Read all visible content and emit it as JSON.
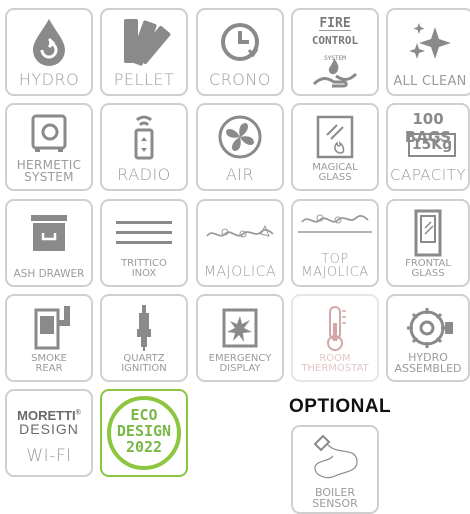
{
  "tiles": {
    "hydro": {
      "label": "HYDRO",
      "icon": "water-drop-icon"
    },
    "pellet": {
      "label": "PELLET",
      "icon": "pellet-swatch-icon"
    },
    "crono": {
      "label": "CRONO",
      "icon": "clock-icon"
    },
    "fire_control": {
      "title": "FIRE",
      "sub": "CONTROL",
      "sub2": "SYSTEM",
      "icon": "hand-flame-icon"
    },
    "all_clean": {
      "label": "ALL CLEAN",
      "icon": "sparkle-icon"
    },
    "hermetic": {
      "label1": "HERMETIC",
      "label2": "SYSTEM",
      "icon": "safe-icon"
    },
    "radio": {
      "label": "RADIO",
      "icon": "remote-icon"
    },
    "air": {
      "label": "AIR",
      "icon": "fan-icon"
    },
    "magical_glass": {
      "label1": "MAGICAL",
      "label2": "GLASS",
      "icon": "glass-flame-icon"
    },
    "capacity": {
      "top": "100 BAGS",
      "badge": "15Kg",
      "label": "CAPACITY"
    },
    "ash_drawer": {
      "label": "ASH DRAWER",
      "icon": "drawer-icon"
    },
    "trittico": {
      "label1": "TRITTICO",
      "label2": "INOX",
      "icon": "lines-icon"
    },
    "majolica": {
      "label": "MAJOLICA",
      "icon": "ornament-icon"
    },
    "top_majolica": {
      "label1": "TOP",
      "label2": "MAJOLICA",
      "icon": "ornament-icon"
    },
    "frontal_glass": {
      "label1": "FRONTAL",
      "label2": "GLASS",
      "icon": "stove-glass-icon"
    },
    "smoke_rear": {
      "label1": "SMOKE",
      "label2": "REAR",
      "icon": "stove-rear-icon"
    },
    "quartz": {
      "label1": "QUARTZ",
      "label2": "IGNITION",
      "icon": "spark-plug-icon"
    },
    "emergency": {
      "label1": "EMERGENCY",
      "label2": "DISPLAY",
      "icon": "broken-display-icon"
    },
    "room_thermo": {
      "label1": "ROOM",
      "label2": "THERMOSTAT",
      "icon": "thermometer-icon"
    },
    "hydro_assembled": {
      "label1": "HYDRO",
      "label2": "ASSEMBLED",
      "icon": "pump-icon"
    },
    "wifi": {
      "brand1": "MORETTI",
      "brand2": "DESIGN",
      "label": "WI-FI",
      "mark": "®"
    },
    "eco": {
      "l1": "ECO",
      "l2": "DESIGN",
      "l3": "2022",
      "color": "#7ab648"
    },
    "boiler": {
      "label1": "BOILER",
      "label2": "SENSOR",
      "icon": "probe-icon"
    }
  },
  "optional_label": "OPTIONAL"
}
